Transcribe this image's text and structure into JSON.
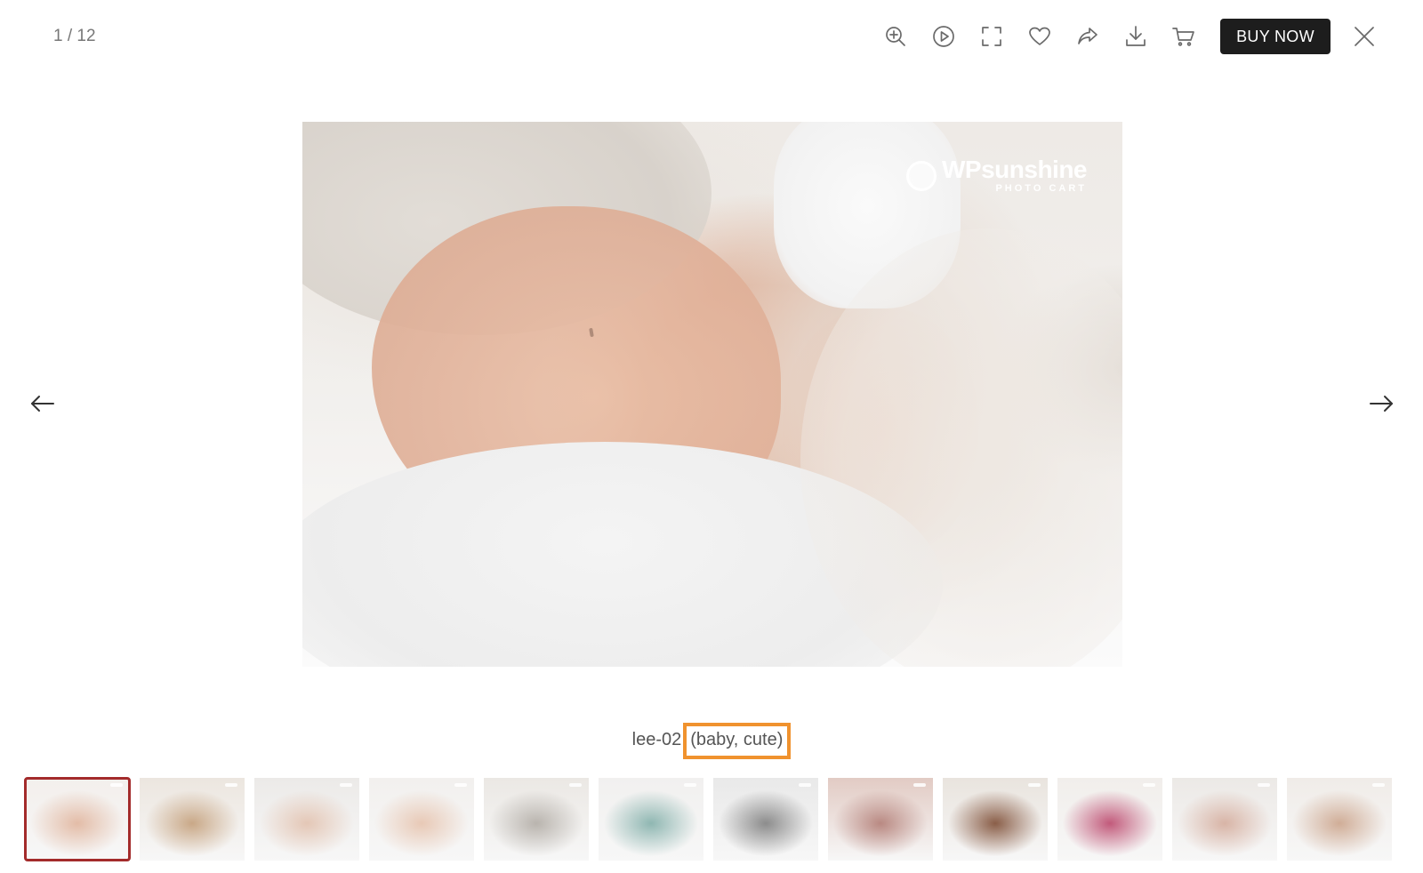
{
  "viewer": {
    "counter": "1 / 12"
  },
  "toolbar": {
    "icons": [
      "zoom-in-icon",
      "play-icon",
      "fullscreen-icon",
      "heart-icon",
      "share-icon",
      "download-icon",
      "cart-icon"
    ],
    "buy_now_label": "BUY NOW",
    "close_icon": "close-icon"
  },
  "navigation": {
    "prev_icon": "arrow-left-icon",
    "next_icon": "arrow-right-icon"
  },
  "photo": {
    "watermark_main": "WPsunshine",
    "watermark_sub": "PHOTO CART"
  },
  "caption": {
    "name": "lee-02",
    "tags": "(baby, cute)",
    "highlight_color": "#f0922e"
  },
  "thumbnails": {
    "active_index": 0,
    "active_border_color": "#a32b2b",
    "items": [
      {
        "colors": [
          "#f3efec",
          "#e3bca7"
        ]
      },
      {
        "colors": [
          "#ece6df",
          "#c9a887"
        ]
      },
      {
        "colors": [
          "#eceae8",
          "#e4c7b6"
        ]
      },
      {
        "colors": [
          "#f2f0ee",
          "#e8c9b6"
        ]
      },
      {
        "colors": [
          "#ebe8e4",
          "#b9b4ae"
        ]
      },
      {
        "colors": [
          "#f1f0ef",
          "#8fb7b2"
        ]
      },
      {
        "colors": [
          "#e9e9e9",
          "#8c8c8c"
        ]
      },
      {
        "colors": [
          "#e2cbc4",
          "#b98982"
        ]
      },
      {
        "colors": [
          "#e9e4de",
          "#8a5e48"
        ]
      },
      {
        "colors": [
          "#f1eeeb",
          "#c25a7b"
        ]
      },
      {
        "colors": [
          "#ece9e6",
          "#d8b4a6"
        ]
      },
      {
        "colors": [
          "#f0ece8",
          "#d0ad97"
        ]
      }
    ]
  }
}
